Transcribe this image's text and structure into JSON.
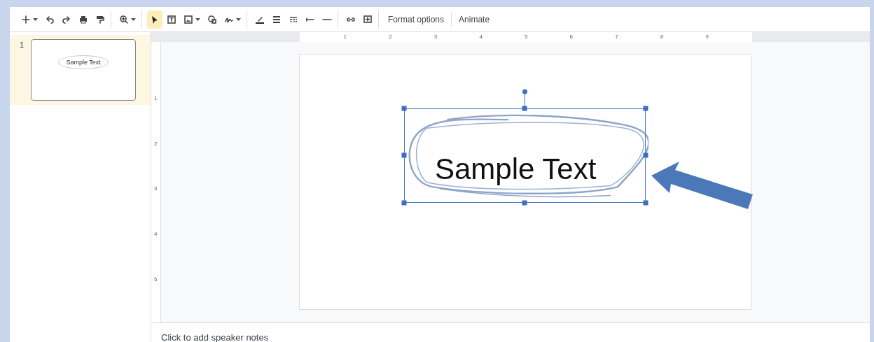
{
  "toolbar": {
    "tools": [
      {
        "kind": "new",
        "has_menu": true,
        "selected": false,
        "divider_after": false
      },
      {
        "kind": "undo",
        "has_menu": false,
        "selected": false,
        "divider_after": false
      },
      {
        "kind": "redo",
        "has_menu": false,
        "selected": false,
        "divider_after": false
      },
      {
        "kind": "print",
        "has_menu": false,
        "selected": false,
        "divider_after": false
      },
      {
        "kind": "paint_format",
        "has_menu": false,
        "selected": false,
        "divider_after": true
      },
      {
        "kind": "zoom",
        "has_menu": true,
        "selected": false,
        "divider_after": true
      },
      {
        "kind": "select",
        "has_menu": false,
        "selected": true,
        "divider_after": false
      },
      {
        "kind": "textbox",
        "has_menu": false,
        "selected": false,
        "divider_after": false
      },
      {
        "kind": "image",
        "has_menu": true,
        "selected": false,
        "divider_after": false
      },
      {
        "kind": "shape",
        "has_menu": false,
        "selected": false,
        "divider_after": false
      },
      {
        "kind": "scribble",
        "has_menu": true,
        "selected": false,
        "divider_after": true
      },
      {
        "kind": "border_color",
        "has_menu": false,
        "selected": false,
        "divider_after": false
      },
      {
        "kind": "border_weight",
        "has_menu": false,
        "selected": false,
        "divider_after": false
      },
      {
        "kind": "border_dash",
        "has_menu": false,
        "selected": false,
        "divider_after": false
      },
      {
        "kind": "line_start",
        "has_menu": false,
        "selected": false,
        "divider_after": false
      },
      {
        "kind": "line_end",
        "has_menu": false,
        "selected": false,
        "divider_after": true
      },
      {
        "kind": "link",
        "has_menu": false,
        "selected": false,
        "divider_after": false
      },
      {
        "kind": "comment",
        "has_menu": false,
        "selected": false,
        "divider_after": true
      }
    ],
    "text_buttons": [
      "Format options",
      "Animate"
    ]
  },
  "filmstrip": [
    {
      "number": "1",
      "selected": true,
      "text": "Sample Text"
    }
  ],
  "rulers": {
    "horizontal": [
      "1",
      "2",
      "3",
      "4",
      "5",
      "6",
      "7",
      "8",
      "9"
    ],
    "vertical": [
      "1",
      "2",
      "3",
      "4",
      "5"
    ]
  },
  "slide": {
    "text": "Sample Text",
    "selected": true
  },
  "speaker_notes": {
    "placeholder": "Click to add speaker notes"
  }
}
